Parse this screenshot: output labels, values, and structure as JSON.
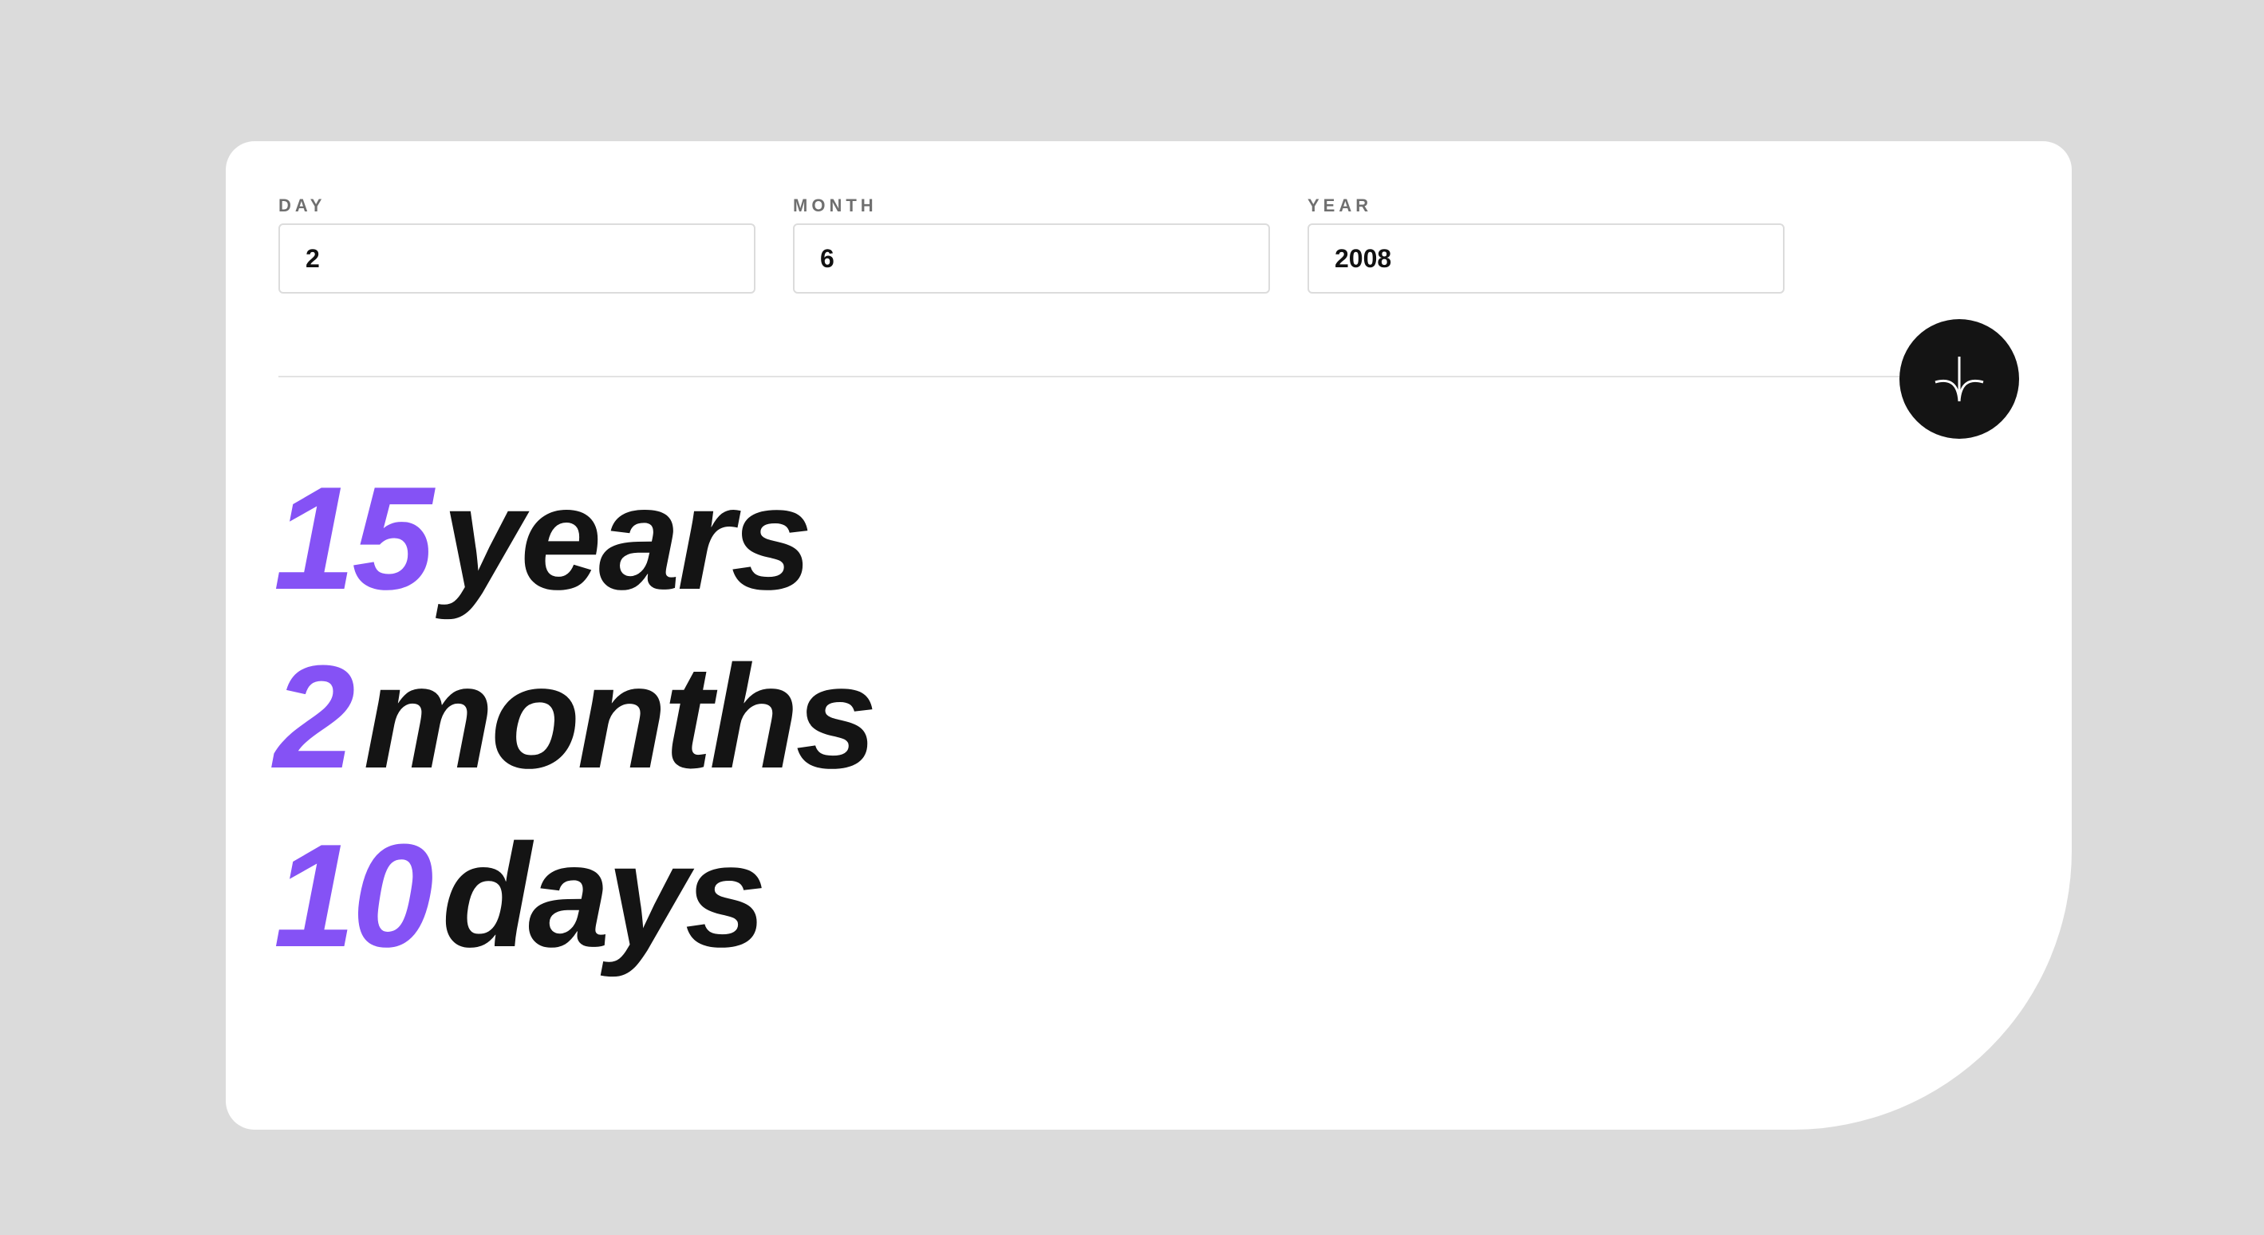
{
  "form": {
    "day": {
      "label": "DAY",
      "value": "2"
    },
    "month": {
      "label": "MONTH",
      "value": "6"
    },
    "year": {
      "label": "YEAR",
      "value": "2008"
    }
  },
  "submit": {
    "icon": "arrow-down-icon"
  },
  "results": {
    "years": {
      "value": "15",
      "unit": "years"
    },
    "months": {
      "value": "2",
      "unit": "months"
    },
    "days": {
      "value": "10",
      "unit": "days"
    }
  },
  "colors": {
    "accent": "#8552f5",
    "text": "#141414",
    "background": "#dbdbdb",
    "card": "#ffffff",
    "label": "#6f6f6f"
  }
}
